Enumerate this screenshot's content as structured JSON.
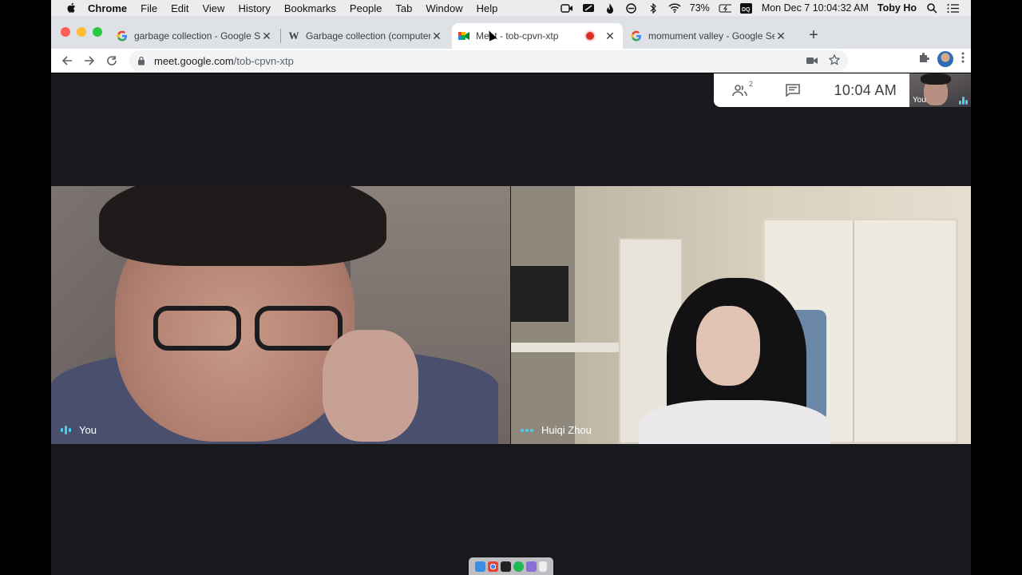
{
  "menubar": {
    "app_name": "Chrome",
    "menus": [
      "File",
      "Edit",
      "View",
      "History",
      "Bookmarks",
      "People",
      "Tab",
      "Window",
      "Help"
    ],
    "battery": "73%",
    "datetime": "Mon Dec 7  10:04:32 AM",
    "user": "Toby Ho"
  },
  "tabs": [
    {
      "title": "garbage collection - Google Se",
      "favicon": "G"
    },
    {
      "title": "Garbage collection (computer s",
      "favicon": "W"
    },
    {
      "title": "Meet - tob-cpvn-xtp",
      "favicon": "meet-icon"
    },
    {
      "title": "momument valley - Google Sea",
      "favicon": "G"
    }
  ],
  "address": {
    "host": "meet.google.com",
    "path": "/tob-cpvn-xtp"
  },
  "meet": {
    "participant_count": "2",
    "clock": "10:04  AM",
    "self_label": "You",
    "tiles": [
      {
        "name": "You"
      },
      {
        "name": "Huiqi Zhou"
      }
    ]
  },
  "colors": {
    "accent": "#4ecde6",
    "recording": "#d93025",
    "meet_bg": "#202124"
  }
}
